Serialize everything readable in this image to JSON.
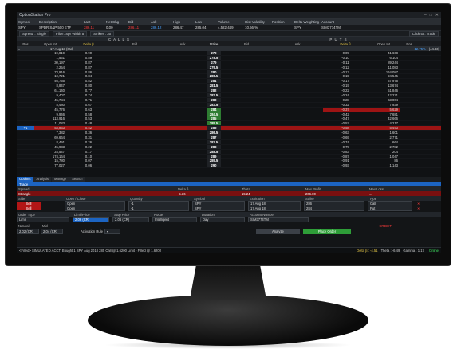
{
  "app": {
    "title": "OptionStation Pro",
    "controls": [
      "–",
      "□",
      "✕"
    ]
  },
  "quote": {
    "headers": [
      "Symbol",
      "Description",
      "Last",
      "Net Chg",
      "Bid",
      "Ask",
      "High",
      "Low",
      "Volume",
      "Hist Volatility",
      "Position",
      "Delta Weighting",
      "Account"
    ],
    "values": [
      "SPY",
      "SPDR S&P 500 ETF",
      "286.11",
      "0.00",
      "286.11",
      "286.12",
      "286.47",
      "285.04",
      "4,522,449",
      "10.66 %",
      "",
      "SPY",
      "SIM3774TM"
    ]
  },
  "toolbar": {
    "spread": "Spread : Single",
    "filter": "Filter: Spr Width 5",
    "strikes": "Strikes : 30",
    "click": "Click to : Trade"
  },
  "banner": {
    "calls": "C A L L S",
    "puts": "P U T S"
  },
  "call_headers": [
    "Pos",
    "Open Int",
    "Delta β",
    "Bid",
    "Ask"
  ],
  "strike_header": "Strike",
  "put_headers": [
    "Bid",
    "Ask",
    "Delta β",
    "Open Int",
    "Pos"
  ],
  "expiry": {
    "label": "17 Aug 18 (Std)",
    "iv": "12.75%",
    "range": "(±4.83)"
  },
  "chain": [
    {
      "oi": "19,819",
      "cd": "0.90",
      "s": "278",
      "pd": "-0.09",
      "poi": "41,668"
    },
    {
      "oi": "1,531",
      "cd": "0.89",
      "s": "278.5",
      "pd": "-0.10",
      "poi": "6,104"
    },
    {
      "oi": "30,197",
      "cd": "0.87",
      "s": "279",
      "pd": "-0.11",
      "poi": "89,244"
    },
    {
      "oi": "2,254",
      "cd": "0.87",
      "s": "279.5",
      "pd": "-0.12",
      "poi": "11,083"
    },
    {
      "oi": "73,916",
      "cd": "0.86",
      "s": "280",
      "pd": "-0.13",
      "poi": "164,087"
    },
    {
      "oi": "10,721",
      "cd": "0.84",
      "s": "280.5",
      "pd": "-0.15",
      "poi": "24,545"
    },
    {
      "oi": "46,755",
      "cd": "0.82",
      "s": "281",
      "pd": "-0.17",
      "poi": "37,976"
    },
    {
      "oi": "8,847",
      "cd": "0.80",
      "s": "281.5",
      "pd": "-0.19",
      "poi": "13,674"
    },
    {
      "oi": "61,140",
      "cd": "0.77",
      "s": "282",
      "pd": "-0.22",
      "poi": "51,846"
    },
    {
      "oi": "9,407",
      "cd": "0.74",
      "s": "282.5",
      "pd": "-0.24",
      "poi": "12,221"
    },
    {
      "oi": "45,784",
      "cd": "0.71",
      "s": "283",
      "pd": "-0.28",
      "poi": "63,004"
    },
    {
      "oi": "8,480",
      "cd": "0.67",
      "s": "283.5",
      "pd": "-0.32",
      "poi": "7,939"
    },
    {
      "oi": "45,776",
      "cd": "0.63",
      "s": "284",
      "pd": "-0.37",
      "poi": "5,629",
      "hlp": true
    },
    {
      "oi": "9,946",
      "cd": "0.58",
      "s": "284.5",
      "pd": "-0.42",
      "poi": "7,681"
    },
    {
      "oi": "113,916",
      "cd": "0.53",
      "s": "285",
      "pd": "-0.47",
      "poi": "42,666"
    },
    {
      "oi": "11,083",
      "cd": "0.48",
      "s": "285.5",
      "pd": "-0.52",
      "poi": "4,217"
    },
    {
      "oi": "53,833",
      "cd": "0.42",
      "s": "286",
      "pd": "-0.58",
      "poi": "5,493",
      "hlc": true,
      "pos": "+1"
    },
    {
      "oi": "7,382",
      "cd": "0.36",
      "s": "286.5",
      "pd": "-0.63",
      "poi": "1,601"
    },
    {
      "oi": "69,664",
      "cd": "0.31",
      "s": "287",
      "pd": "-0.69",
      "poi": "2,771"
    },
    {
      "oi": "8,491",
      "cd": "0.26",
      "s": "287.5",
      "pd": "-0.74",
      "poi": "664"
    },
    {
      "oi": "45,933",
      "cd": "0.22",
      "s": "288",
      "pd": "-0.79",
      "poi": "2,782"
    },
    {
      "oi": "24,547",
      "cd": "0.17",
      "s": "288.5",
      "pd": "-0.83",
      "poi": "204"
    },
    {
      "oi": "174,164",
      "cd": "0.10",
      "s": "289",
      "pd": "-0.87",
      "poi": "1,047"
    },
    {
      "oi": "15,780",
      "cd": "0.07",
      "s": "289.5",
      "pd": "-0.91",
      "poi": "86"
    },
    {
      "oi": "77,027",
      "cd": "0.06",
      "s": "290",
      "pd": "-0.93",
      "poi": "1,143"
    }
  ],
  "tabs": [
    "Options",
    "Analysis",
    "Manage",
    "Search"
  ],
  "trade": {
    "title": "Trade",
    "summary_headers": [
      "Spread",
      "Delta β",
      "Theta",
      "Max Profit",
      "Max Loss"
    ],
    "summary_values": [
      "Strangle",
      "-5.36",
      "15.24",
      "206.00",
      "∞"
    ],
    "leg_headers": [
      "Side",
      "Open / Close",
      "Quantity",
      "Symbol",
      "Expiration",
      "Strike",
      "Type"
    ],
    "legs": [
      [
        "Sell",
        "Open",
        "-1",
        "SPY",
        "17 Aug 18",
        "286",
        "Call"
      ],
      [
        "Sell",
        "Open",
        "-1",
        "SPY",
        "17 Aug 18",
        "284",
        "Put"
      ]
    ],
    "order_headers": [
      "Order Type",
      "Limit/Price",
      "Stop Price",
      "Route",
      "Duration",
      "Account Number"
    ],
    "order_values": [
      "Limit",
      "2.06 (CR)",
      "2.06 (CR)",
      "Intelligent",
      "Day",
      "SIM3774TM"
    ],
    "natural_label": "Natural",
    "natural": "2.02 (CR)",
    "mid_label": "Mid",
    "mid": "2.04 (CR)",
    "activation_label": "Activation Rule",
    "analyze": "Analyze",
    "place": "Place Order",
    "credit": "CREDIT"
  },
  "status": {
    "msg": "<Filled> SIMULATED ACCT: Bought 1 SPY Aug 2018 285 Call @ 1.6200 Limit - Filled @ 1.6200",
    "delta": "Delta β : -4.51",
    "theta": "Theta : -6.49",
    "gamma": "Gamma : 1.17",
    "online": "Online"
  }
}
